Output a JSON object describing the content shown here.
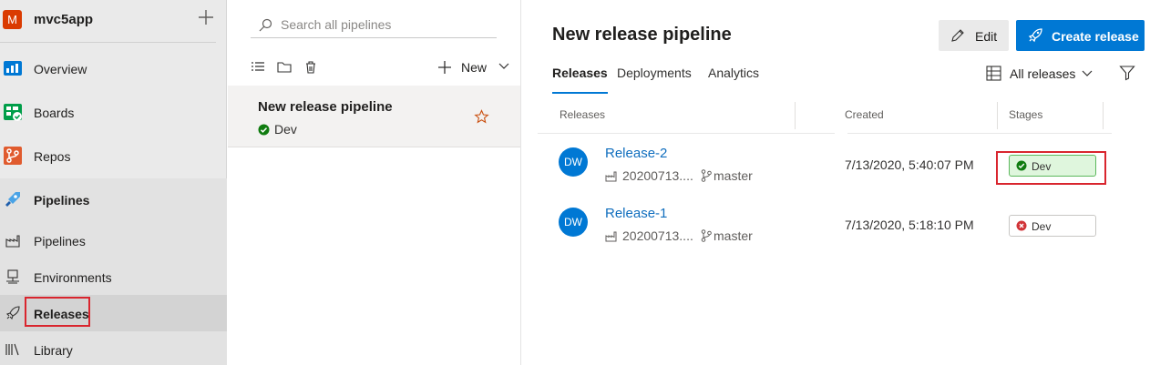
{
  "nav": {
    "project_initial": "M",
    "project_name": "mvc5app",
    "items": [
      {
        "label": "Overview"
      },
      {
        "label": "Boards"
      },
      {
        "label": "Repos"
      },
      {
        "label": "Pipelines"
      }
    ],
    "sub_items": [
      {
        "label": "Pipelines"
      },
      {
        "label": "Environments"
      },
      {
        "label": "Releases"
      },
      {
        "label": "Library"
      }
    ]
  },
  "pipelines_panel": {
    "search_placeholder": "Search all pipelines",
    "new_label": "New",
    "selected_pipeline": {
      "name": "New release pipeline",
      "stage": "Dev"
    }
  },
  "main": {
    "title": "New release pipeline",
    "edit_label": "Edit",
    "create_label": "Create release",
    "tabs": [
      {
        "label": "Releases"
      },
      {
        "label": "Deployments"
      },
      {
        "label": "Analytics"
      }
    ],
    "filter_label": "All releases",
    "columns": {
      "releases": "Releases",
      "created": "Created",
      "stages": "Stages"
    },
    "releases": [
      {
        "avatar": "DW",
        "name": "Release-2",
        "artifact": "20200713....",
        "branch": "master",
        "created": "7/13/2020, 5:40:07 PM",
        "stage": "Dev",
        "stage_status": "succeeded"
      },
      {
        "avatar": "DW",
        "name": "Release-1",
        "artifact": "20200713....",
        "branch": "master",
        "created": "7/13/2020, 5:18:10 PM",
        "stage": "Dev",
        "stage_status": "failed"
      }
    ]
  },
  "colors": {
    "accent": "#0078d4",
    "highlight": "#d9252e",
    "success": "#107c10",
    "failure": "#d13438"
  }
}
